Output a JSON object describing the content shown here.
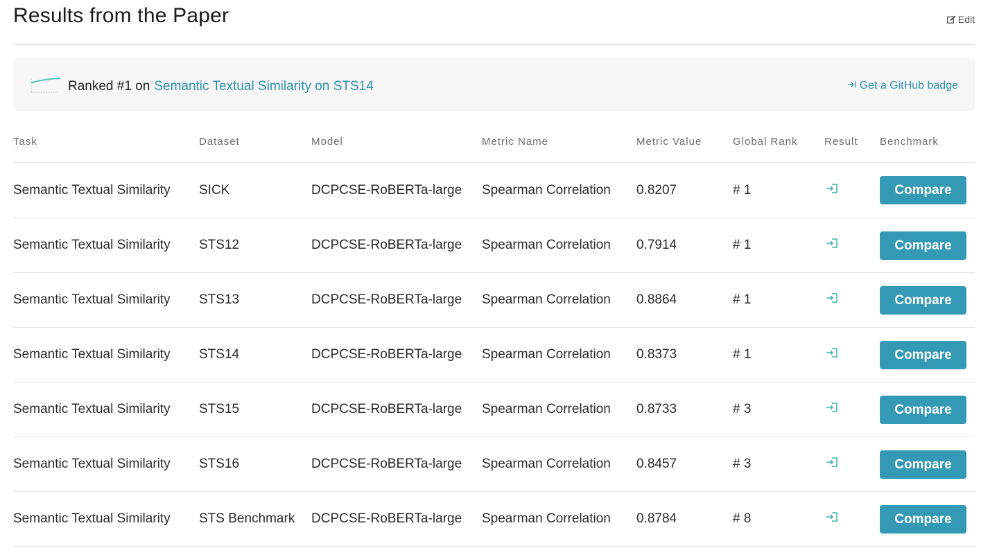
{
  "header": {
    "title": "Results from the Paper",
    "edit_label": "Edit"
  },
  "ranking": {
    "prefix": "Ranked #1 on",
    "link_text": "Semantic Textual Similarity on STS14",
    "badge_label": "Get a GitHub badge"
  },
  "table": {
    "columns": [
      "Task",
      "Dataset",
      "Model",
      "Metric Name",
      "Metric Value",
      "Global Rank",
      "Result",
      "Benchmark"
    ],
    "rows": [
      {
        "task": "Semantic Textual Similarity",
        "dataset": "SICK",
        "model": "DCPCSE-RoBERTa-large",
        "metric_name": "Spearman Correlation",
        "metric_value": "0.8207",
        "global_rank": "# 1",
        "benchmark": "Compare"
      },
      {
        "task": "Semantic Textual Similarity",
        "dataset": "STS12",
        "model": "DCPCSE-RoBERTa-large",
        "metric_name": "Spearman Correlation",
        "metric_value": "0.7914",
        "global_rank": "# 1",
        "benchmark": "Compare"
      },
      {
        "task": "Semantic Textual Similarity",
        "dataset": "STS13",
        "model": "DCPCSE-RoBERTa-large",
        "metric_name": "Spearman Correlation",
        "metric_value": "0.8864",
        "global_rank": "# 1",
        "benchmark": "Compare"
      },
      {
        "task": "Semantic Textual Similarity",
        "dataset": "STS14",
        "model": "DCPCSE-RoBERTa-large",
        "metric_name": "Spearman Correlation",
        "metric_value": "0.8373",
        "global_rank": "# 1",
        "benchmark": "Compare"
      },
      {
        "task": "Semantic Textual Similarity",
        "dataset": "STS15",
        "model": "DCPCSE-RoBERTa-large",
        "metric_name": "Spearman Correlation",
        "metric_value": "0.8733",
        "global_rank": "# 3",
        "benchmark": "Compare"
      },
      {
        "task": "Semantic Textual Similarity",
        "dataset": "STS16",
        "model": "DCPCSE-RoBERTa-large",
        "metric_name": "Spearman Correlation",
        "metric_value": "0.8457",
        "global_rank": "# 3",
        "benchmark": "Compare"
      },
      {
        "task": "Semantic Textual Similarity",
        "dataset": "STS Benchmark",
        "model": "DCPCSE-RoBERTa-large",
        "metric_name": "Spearman Correlation",
        "metric_value": "0.8784",
        "global_rank": "# 8",
        "benchmark": "Compare"
      }
    ]
  },
  "icons": {
    "edit": "edit-icon",
    "sparkline": "sparkline-icon",
    "badge": "badge-arrow-icon",
    "result": "result-link-icon"
  },
  "colors": {
    "accent": "#2b8fb0",
    "button": "#3499b4",
    "result_icon": "#3bb3a4",
    "rank_box_bg": "#f7f7f7"
  }
}
